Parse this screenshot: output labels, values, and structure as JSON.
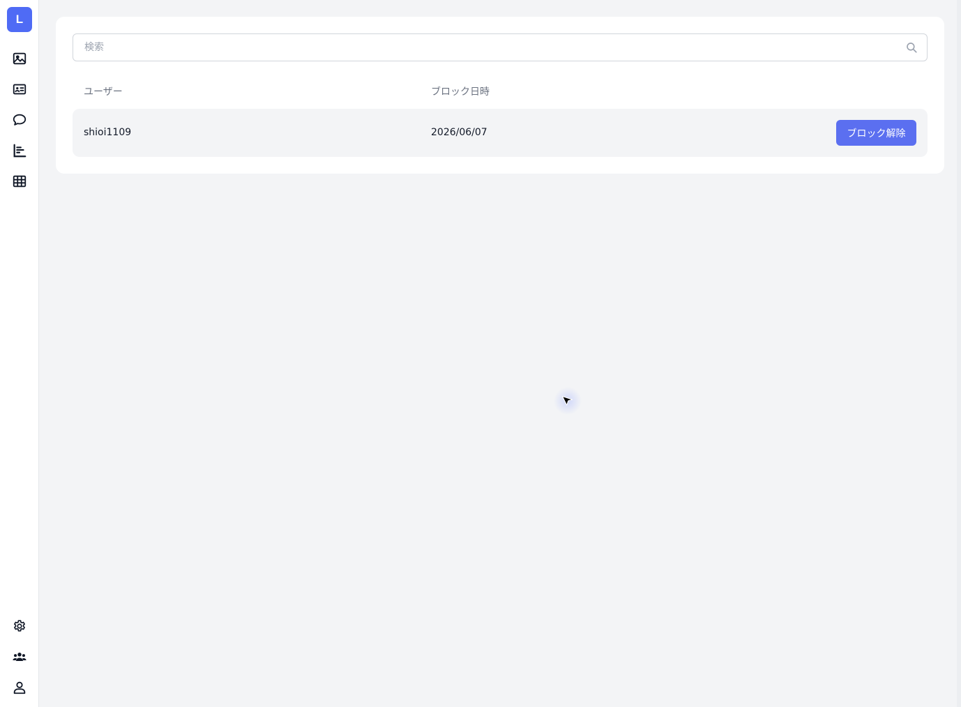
{
  "sidebar": {
    "logo_letter": "L",
    "top_icons": [
      "image-icon",
      "contact-card-icon",
      "chat-bubble-icon",
      "bar-chart-icon",
      "table-grid-icon"
    ],
    "bottom_icons": [
      "gear-icon",
      "users-group-icon",
      "user-icon"
    ],
    "accent_color": "#4f6bf5"
  },
  "search": {
    "placeholder": "検索",
    "value": ""
  },
  "table": {
    "headers": {
      "user": "ユーザー",
      "blocked_at": "ブロック日時"
    },
    "rows": [
      {
        "user": "shioi1109",
        "blocked_at": "2026/06/07",
        "action_label": "ブロック解除"
      }
    ]
  },
  "colors": {
    "button": "#5b6ff0",
    "page_background": "#f3f4f6",
    "card_background": "#ffffff"
  }
}
